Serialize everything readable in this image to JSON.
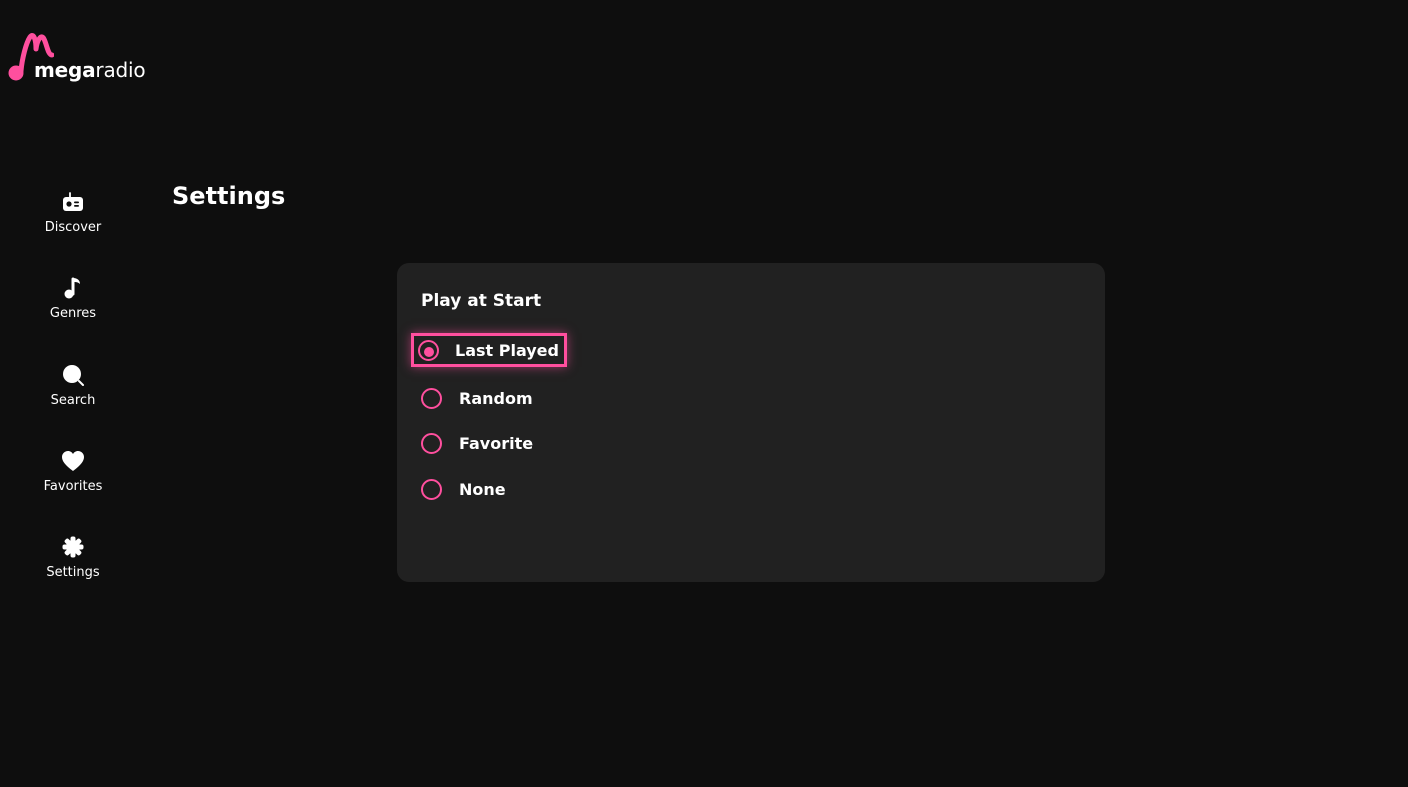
{
  "app": {
    "logo_bold": "mega",
    "logo_light": "radio",
    "accent_color": "#ff4f9e",
    "background_color": "#0e0e0e",
    "card_color": "#212121"
  },
  "sidebar": {
    "items": [
      {
        "label": "Discover",
        "icon": "radio-icon"
      },
      {
        "label": "Genres",
        "icon": "music-note-icon"
      },
      {
        "label": "Search",
        "icon": "search-icon"
      },
      {
        "label": "Favorites",
        "icon": "heart-icon"
      },
      {
        "label": "Settings",
        "icon": "gear-icon"
      }
    ]
  },
  "page": {
    "title": "Settings"
  },
  "play_at_start": {
    "title": "Play at Start",
    "selected": "Last Played",
    "options": [
      {
        "label": "Last Played",
        "checked": true,
        "focused": true
      },
      {
        "label": "Random",
        "checked": false,
        "focused": false
      },
      {
        "label": "Favorite",
        "checked": false,
        "focused": false
      },
      {
        "label": "None",
        "checked": false,
        "focused": false
      }
    ]
  }
}
